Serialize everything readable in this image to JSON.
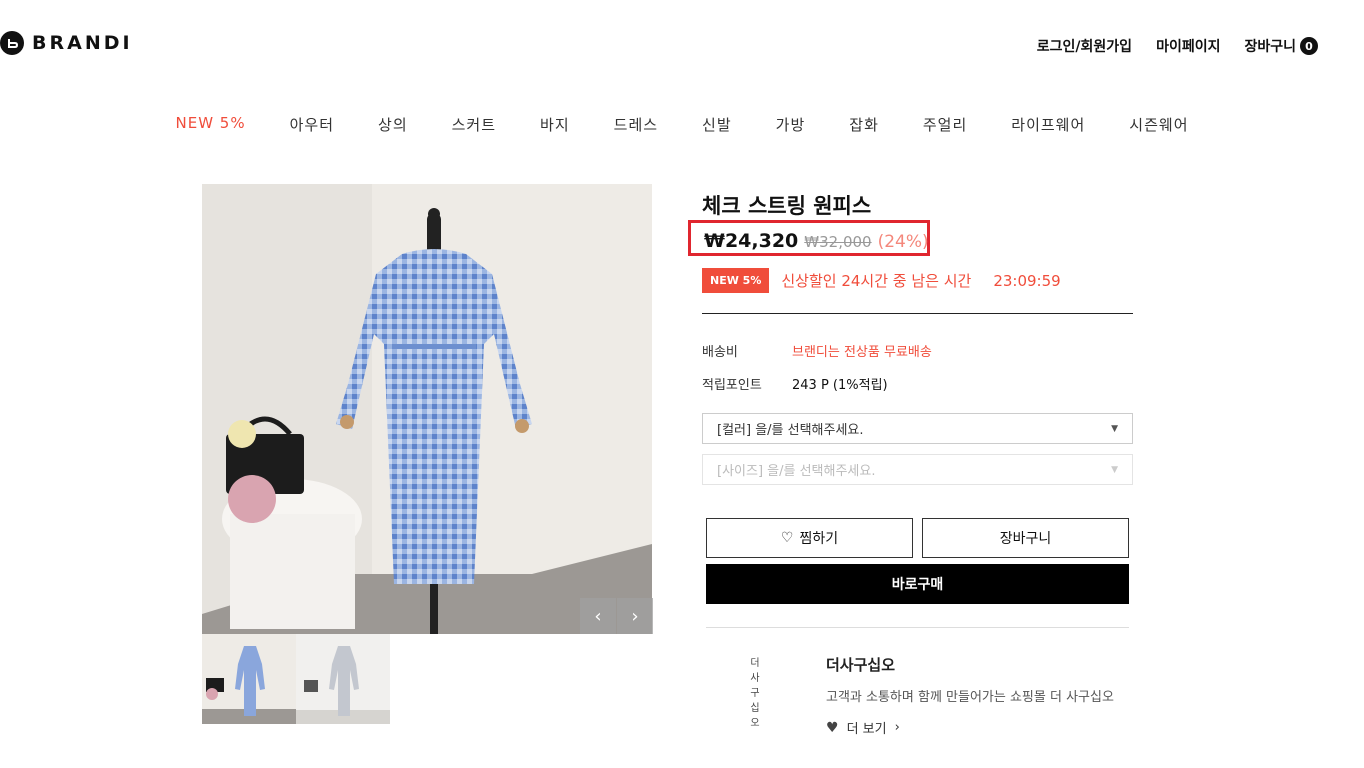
{
  "brand": {
    "name": "BRANDI"
  },
  "header": {
    "login": "로그인/회원가입",
    "mypage": "마이페이지",
    "cart_label": "장바구니",
    "cart_count": "0"
  },
  "categories": [
    "NEW 5%",
    "아우터",
    "상의",
    "스커트",
    "바지",
    "드레스",
    "신발",
    "가방",
    "잡화",
    "주얼리",
    "라이프웨어",
    "시즌웨어"
  ],
  "product": {
    "title": "체크 스트링 원피스",
    "price": "₩24,320",
    "original_price": "₩32,000",
    "discount": "(24%)",
    "badge": "NEW 5%",
    "promo_text": "신상할인 24시간 중 남은 시간",
    "timer": "23:09:59",
    "shipping_label": "배송비",
    "shipping_value": "브랜디는 전상품 무료배송",
    "points_label": "적립포인트",
    "points_value": "243 P (1%적립)",
    "color_select": "[컬러] 을/를 선택해주세요.",
    "size_select": "[사이즈] 을/를 선택해주세요.",
    "wish_label": "찜하기",
    "cart_label": "장바구니",
    "buy_label": "바로구매"
  },
  "seller": {
    "vertical_chars": [
      "더",
      "사",
      "구",
      "십",
      "오"
    ],
    "name": "더사구십오",
    "description": "고객과 소통하며 함께 만들어가는 쇼핑몰 더 사구십오",
    "more_label": "더 보기"
  },
  "colors": {
    "accent": "#f04d3b",
    "highlight_box": "#e0262f"
  }
}
